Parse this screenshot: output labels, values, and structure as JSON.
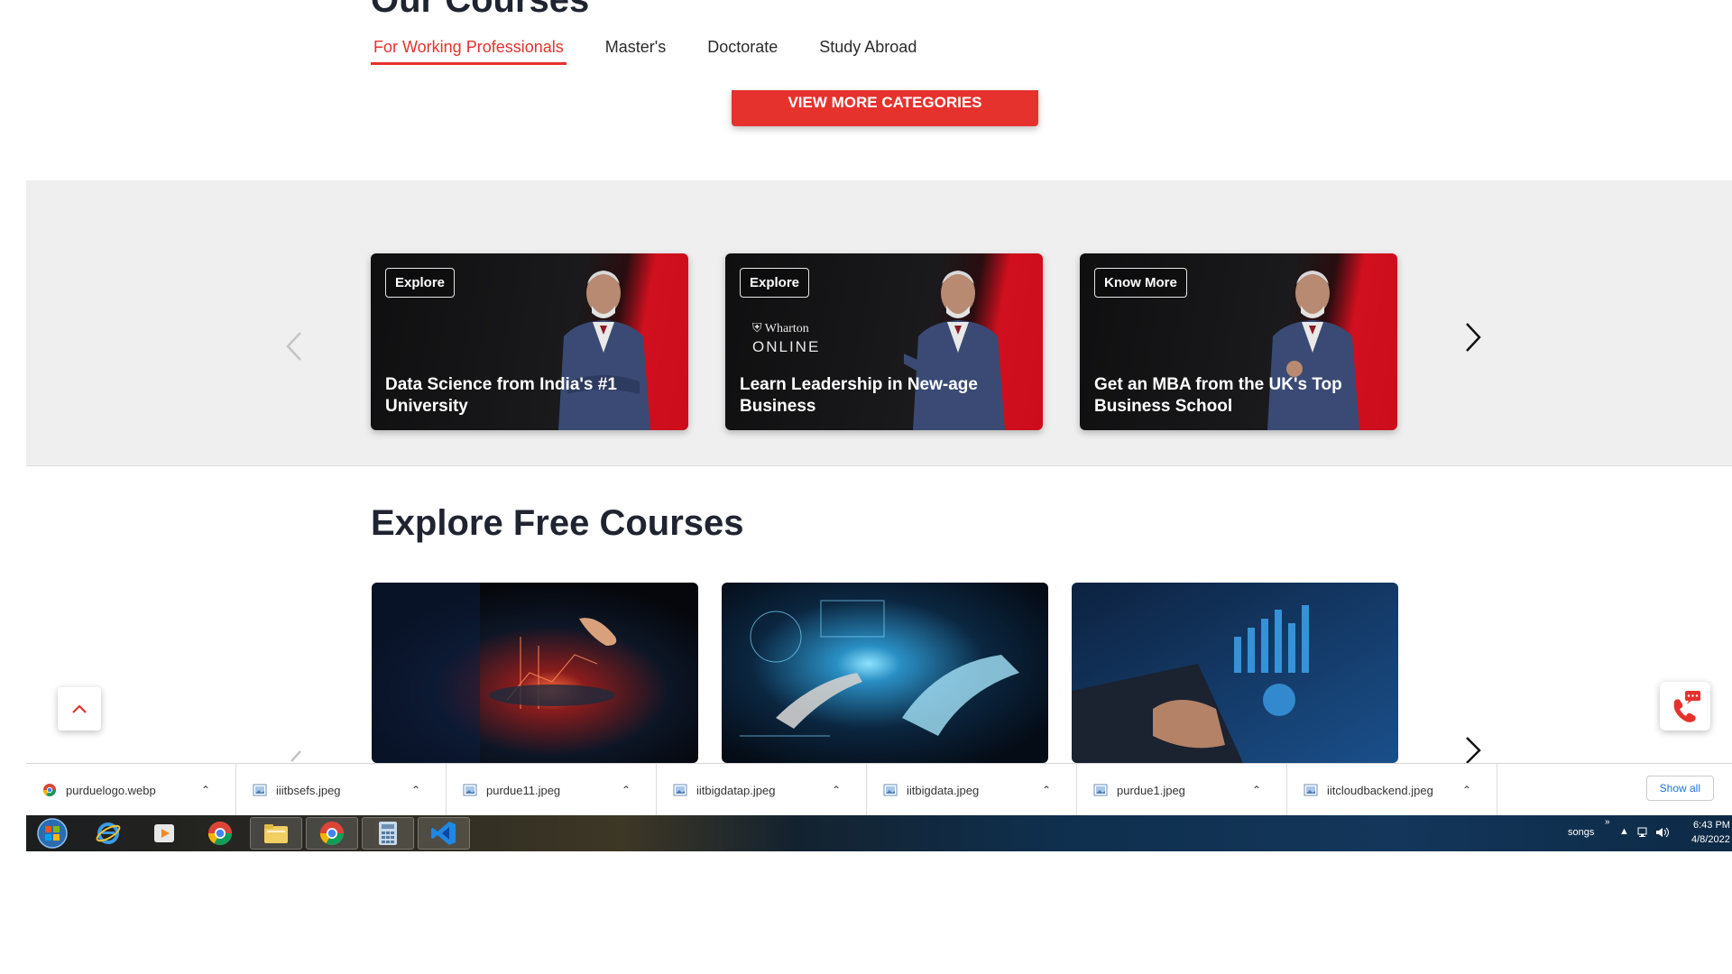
{
  "section": {
    "title": "Our Courses",
    "tabs": [
      {
        "label": "For Working Professionals",
        "active": true
      },
      {
        "label": "Master's",
        "active": false
      },
      {
        "label": "Doctorate",
        "active": false
      },
      {
        "label": "Study Abroad",
        "active": false
      }
    ],
    "view_more_label": "VIEW MORE CATEGORIES"
  },
  "promos": [
    {
      "badge": "Explore",
      "caption": "Data Science from India's #1 University"
    },
    {
      "badge": "Explore",
      "caption": "Learn Leadership in New-age Business",
      "logo_line1": "Wharton",
      "logo_line2": "ONLINE"
    },
    {
      "badge": "Know More",
      "caption": "Get an MBA from the UK's Top Business School"
    }
  ],
  "free_courses": {
    "title": "Explore Free Courses"
  },
  "downloads": {
    "items": [
      {
        "name": "purduelogo.webp",
        "icon": "chrome-icon"
      },
      {
        "name": "iiitbsefs.jpeg",
        "icon": "image-file-icon"
      },
      {
        "name": "purdue11.jpeg",
        "icon": "image-file-icon"
      },
      {
        "name": "iitbigdatap.jpeg",
        "icon": "image-file-icon"
      },
      {
        "name": "iitbigdata.jpeg",
        "icon": "image-file-icon"
      },
      {
        "name": "purdue1.jpeg",
        "icon": "image-file-icon"
      },
      {
        "name": "iitcloudbackend.jpeg",
        "icon": "image-file-icon"
      }
    ],
    "show_all": "Show all"
  },
  "taskbar": {
    "tray_label": "songs",
    "time": "6:43 PM",
    "date": "4/8/2022"
  },
  "colors": {
    "accent": "#e5322d",
    "band": "#efefef"
  }
}
